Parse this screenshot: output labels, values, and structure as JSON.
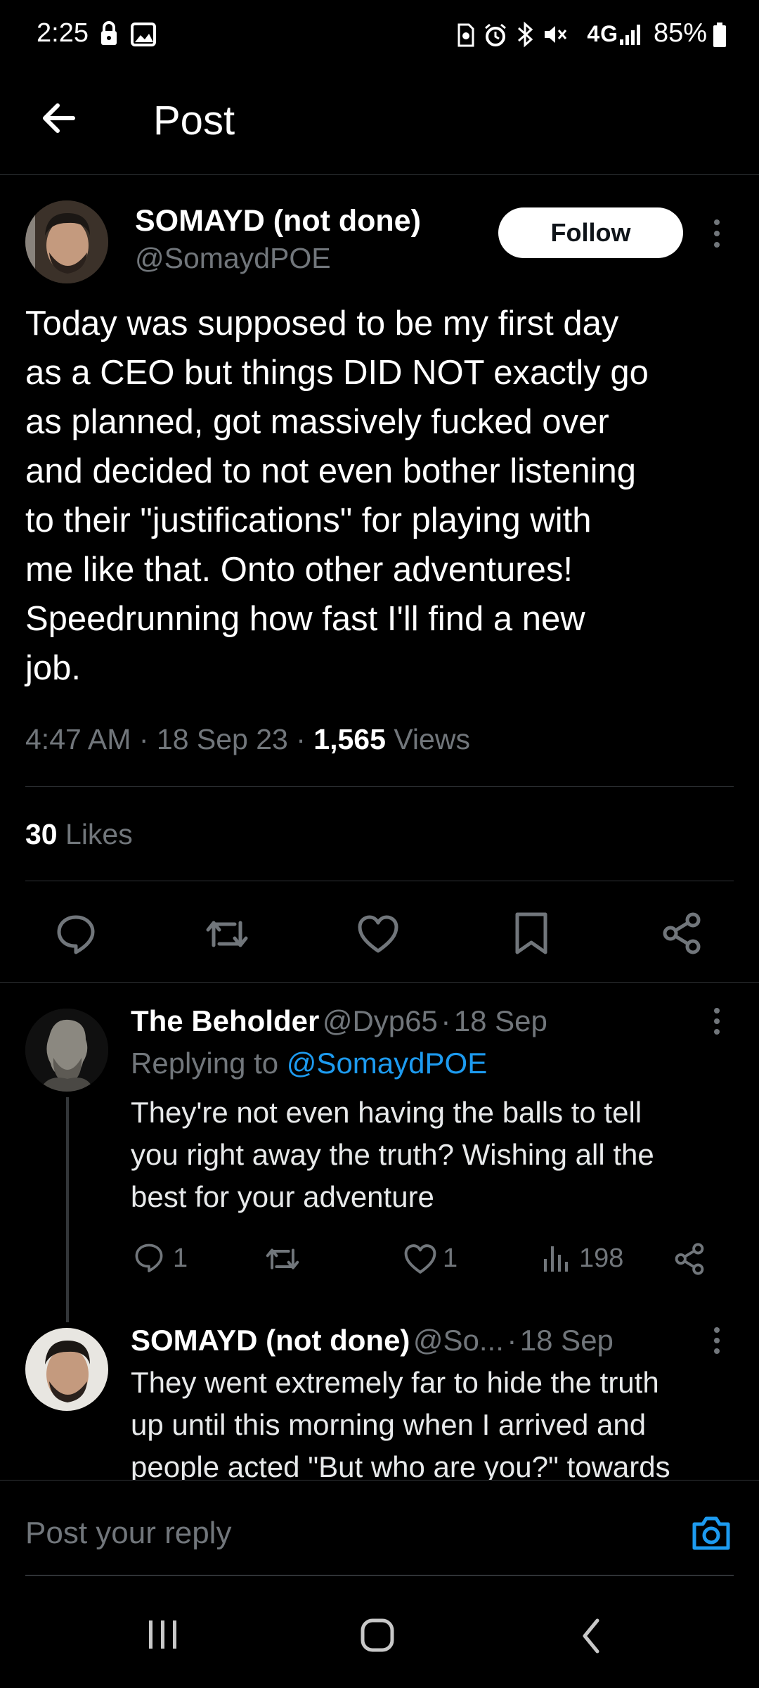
{
  "status_bar": {
    "time": "2:25",
    "network": "4G",
    "battery": "85%"
  },
  "header": {
    "title": "Post",
    "back_icon": "arrow-left-icon"
  },
  "post": {
    "author_name": "SOMAYD (not done)",
    "author_handle": "@SomaydPOE",
    "follow_label": "Follow",
    "text": "Today was supposed to be my first day\nas a CEO but things DID NOT exactly go\nas planned, got massively fucked over\nand decided to not even bother listening\nto their \"justifications\" for playing with\nme like that. Onto other adventures!\nSpeedrunning how fast I'll find a new\njob.",
    "time": "4:47 AM",
    "date": "18 Sep 23",
    "views_count": "1,565",
    "views_label": "Views",
    "likes_count": "30",
    "likes_label": "Likes"
  },
  "replies": [
    {
      "name": "The Beholder",
      "handle": "@Dyp65",
      "date": "18 Sep",
      "replying_to_label": "Replying to",
      "replying_to_handle": "@SomaydPOE",
      "text": "They're not even having the balls to tell\nyou right away the truth? Wishing all the\nbest for your adventure",
      "reply_count": "1",
      "like_count": "1",
      "view_count": "198"
    },
    {
      "name": "SOMAYD (not done)",
      "handle": "@So...",
      "date": "18 Sep",
      "text": "They went extremely far to hide the truth\nup until this morning when I arrived and\npeople acted \"But who are you?\" towards"
    }
  ],
  "composer": {
    "placeholder": "Post your reply"
  },
  "colors": {
    "accent": "#1d9bf0",
    "background": "#000000",
    "muted": "#71767b"
  }
}
